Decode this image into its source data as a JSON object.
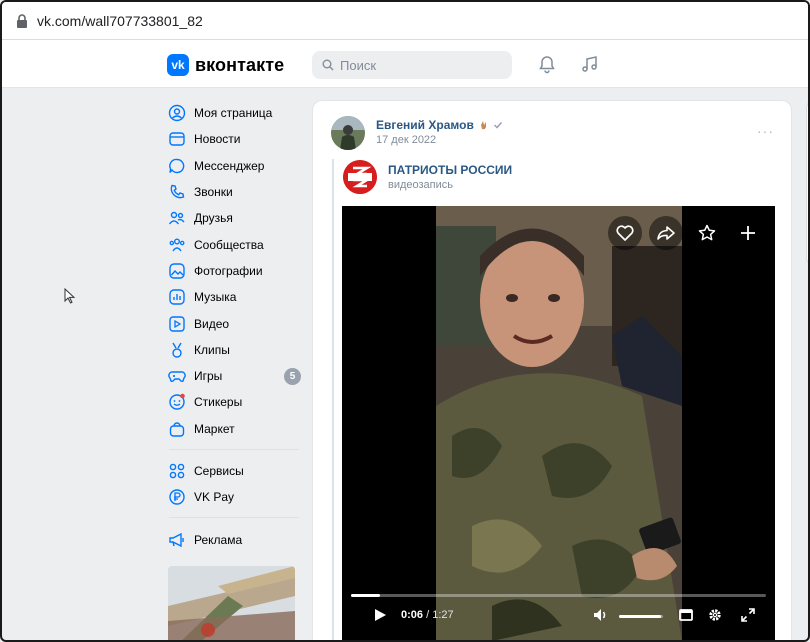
{
  "browser": {
    "url": "vk.com/wall707733801_82"
  },
  "header": {
    "logo_text": "вконтакте",
    "logo_mark": "vk",
    "search_placeholder": "Поиск"
  },
  "sidebar": {
    "items": [
      {
        "label": "Моя страница",
        "icon": "user-circle-icon"
      },
      {
        "label": "Новости",
        "icon": "news-icon"
      },
      {
        "label": "Мессенджер",
        "icon": "message-icon"
      },
      {
        "label": "Звонки",
        "icon": "phone-icon"
      },
      {
        "label": "Друзья",
        "icon": "friends-icon"
      },
      {
        "label": "Сообщества",
        "icon": "communities-icon"
      },
      {
        "label": "Фотографии",
        "icon": "photo-icon"
      },
      {
        "label": "Музыка",
        "icon": "music-icon"
      },
      {
        "label": "Видео",
        "icon": "video-icon"
      },
      {
        "label": "Клипы",
        "icon": "clips-icon"
      },
      {
        "label": "Игры",
        "icon": "gamepad-icon",
        "badge": "5"
      },
      {
        "label": "Стикеры",
        "icon": "sticker-icon"
      },
      {
        "label": "Маркет",
        "icon": "bag-icon"
      }
    ],
    "items2": [
      {
        "label": "Сервисы",
        "icon": "services-icon"
      },
      {
        "label": "VK Pay",
        "icon": "vkpay-icon"
      }
    ],
    "items3": [
      {
        "label": "Реклама",
        "icon": "megaphone-icon"
      }
    ]
  },
  "post": {
    "author": "Евгений Храмов",
    "date": "17 дек 2022",
    "more": "···",
    "repost": {
      "group": "ПАТРИОТЫ РОССИИ",
      "type": "видеозапись"
    },
    "video": {
      "current_time": "0:06",
      "duration": "/ 1:27",
      "progress": 0.07,
      "volume": 0.95
    }
  },
  "colors": {
    "accent": "#0077ff",
    "link": "#2a5885",
    "muted": "#818c99",
    "bg": "#edeef0"
  }
}
